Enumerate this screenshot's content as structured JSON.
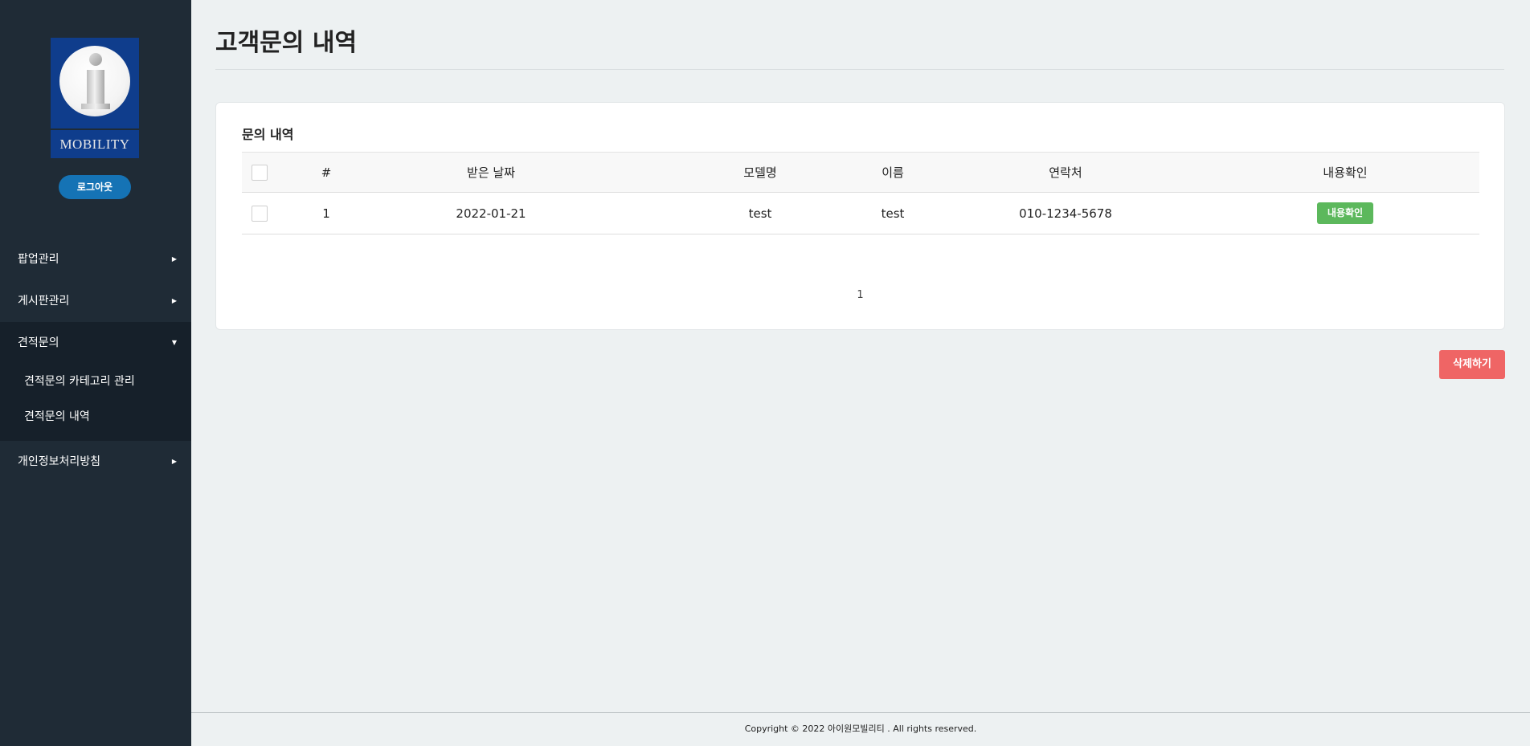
{
  "sidebar": {
    "logo_text": "MOBILITY",
    "logout_label": "로그아웃",
    "menu": [
      {
        "label": "팝업관리",
        "expanded": false
      },
      {
        "label": "게시판관리",
        "expanded": false
      },
      {
        "label": "견적문의",
        "expanded": true,
        "children": [
          "견적문의 카테고리 관리",
          "견적문의 내역"
        ]
      },
      {
        "label": "개인정보처리방침",
        "expanded": false
      }
    ]
  },
  "page": {
    "title": "고객문의 내역"
  },
  "card": {
    "title": "문의 내역",
    "columns": [
      "#",
      "받은 날짜",
      "모델명",
      "이름",
      "연락처",
      "내용확인"
    ],
    "rows": [
      {
        "num": "1",
        "date": "2022-01-21",
        "model": "test",
        "name": "test",
        "phone": "010-1234-5678",
        "action": "내용확인"
      }
    ],
    "pagination": "1"
  },
  "actions": {
    "delete_label": "삭제하기"
  },
  "footer": {
    "copyright": "Copyright © 2022 아이원모빌리티 . All rights reserved."
  },
  "colors": {
    "sidebar_bg": "#1f2b36",
    "logout_btn": "#1573b5",
    "view_btn": "#5cb85c",
    "delete_btn": "#ef6565"
  }
}
